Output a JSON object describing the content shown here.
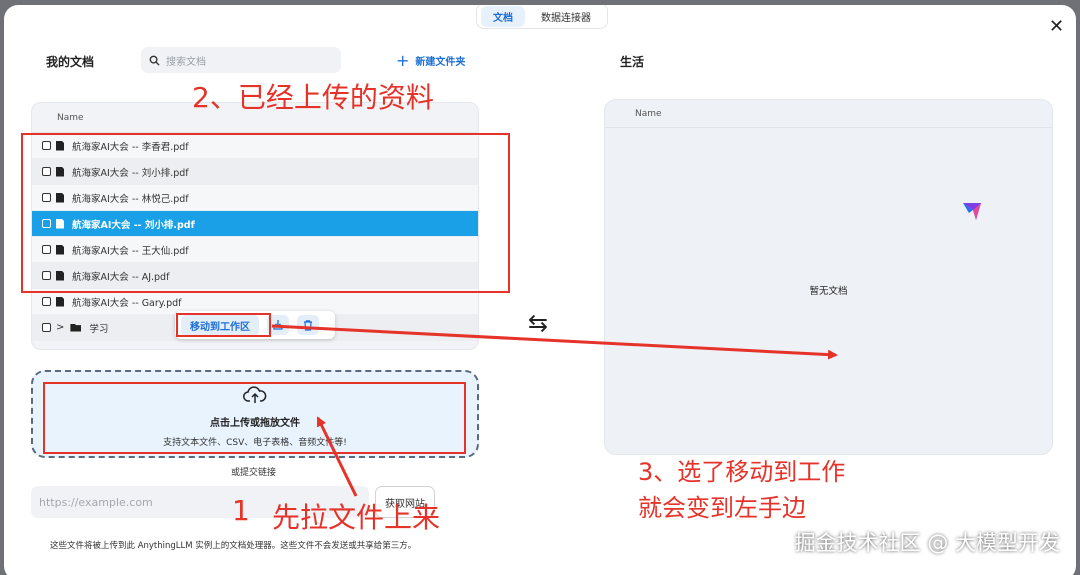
{
  "tabs": [
    {
      "label": "文档",
      "active": true
    },
    {
      "label": "数据连接器",
      "active": false
    }
  ],
  "left": {
    "title": "我的文档",
    "search_placeholder": "搜索文档",
    "new_folder": "新建文件夹",
    "column": "Name",
    "files": [
      {
        "name": "航海家AI大会 -- 李香君.pdf",
        "selected": false
      },
      {
        "name": "航海家AI大会 -- 刘小排.pdf",
        "selected": false
      },
      {
        "name": "航海家AI大会 -- 林悦己.pdf",
        "selected": false
      },
      {
        "name": "航海家AI大会 -- 刘小排.pdf",
        "selected": true
      },
      {
        "name": "航海家AI大会 -- 王大仙.pdf",
        "selected": false
      },
      {
        "name": "航海家AI大会 -- AJ.pdf",
        "selected": false
      },
      {
        "name": "航海家AI大会 -- Gary.pdf",
        "selected": false
      }
    ],
    "folder": "学习",
    "move_button": "移动到工作区"
  },
  "upload": {
    "title": "点击上传或拖放文件",
    "subtitle": "支持文本文件、CSV、电子表格、音频文件等!",
    "or_link": "或提交链接",
    "url_placeholder": "https://example.com",
    "fetch_button": "获取网站",
    "disclaimer": "这些文件将被上传到此 AnythingLLM 实例上的文档处理器。这些文件不会发送或共享给第三方。"
  },
  "right": {
    "title": "生活",
    "column": "Name",
    "empty": "暂无文档"
  },
  "annotations": {
    "a1": "2、已经上传的资料",
    "a2": "1",
    "a3": "先拉文件上来",
    "a4_line1": "3、选了移动到工作",
    "a4_line2": "就会变到左手边"
  },
  "watermark": "掘金技术社区 @ 大模型开发",
  "colors": {
    "accent": "#1e6fd6",
    "selected_row": "#1aa0e6",
    "annotation": "#e5332a"
  }
}
